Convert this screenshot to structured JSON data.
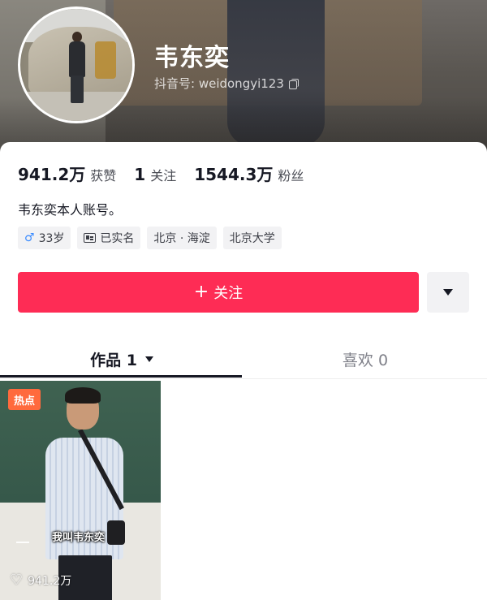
{
  "profile": {
    "name": "韦东奕",
    "account_label": "抖音号: weidongyi123"
  },
  "stats": [
    {
      "value": "941.2万",
      "label": "获赞"
    },
    {
      "value": "1",
      "label": "关注"
    },
    {
      "value": "1544.3万",
      "label": "粉丝"
    }
  ],
  "bio": "韦东奕本人账号。",
  "tags": {
    "age": "33岁",
    "verified": "已实名",
    "location": "北京 · 海淀",
    "school": "北京大学"
  },
  "actions": {
    "follow_plus": "+",
    "follow_label": "关注"
  },
  "tabs": {
    "works": "作品 1",
    "likes": "喜欢 0"
  },
  "video": {
    "badge": "热点",
    "caption": "我叫韦东奕",
    "likes": "941.2万"
  },
  "colors": {
    "accent": "#fe2c55",
    "hot_badge": "#ff6a3d",
    "male": "#3a8bff"
  },
  "icons": {
    "male": "male-icon",
    "id": "id-card-icon",
    "copy": "copy-icon",
    "heart": "heart-icon",
    "dropdown": "chevron-down-icon"
  }
}
